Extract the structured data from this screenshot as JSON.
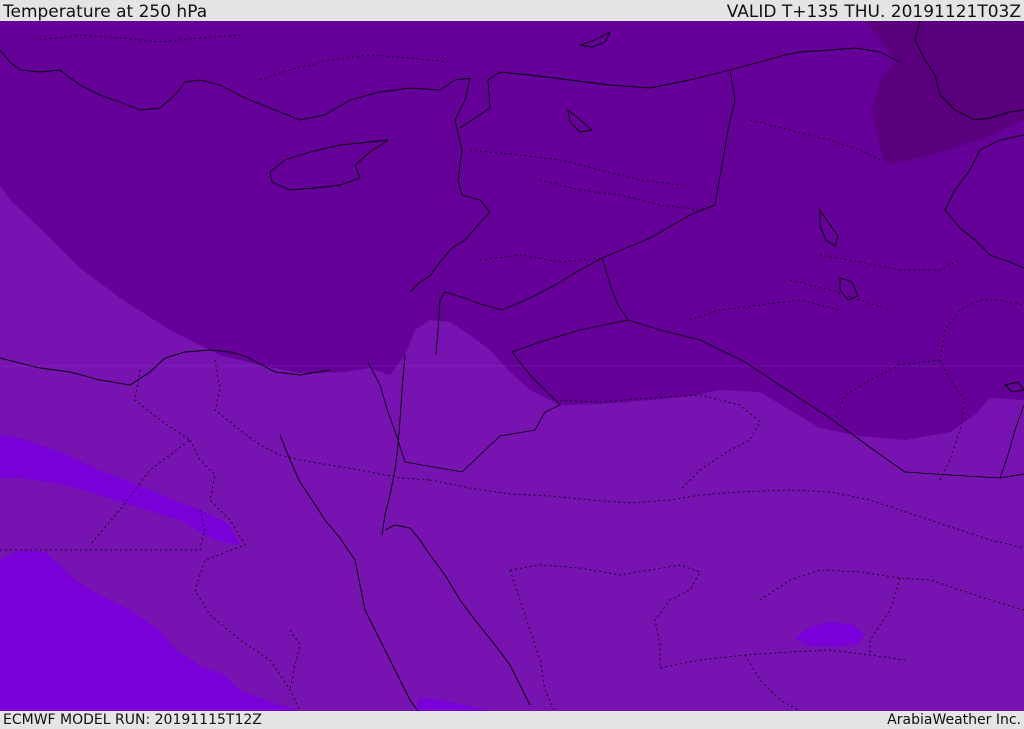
{
  "header": {
    "title": "Temperature at 250 hPa",
    "valid_time": "VALID T+135 THU. 20191121T03Z"
  },
  "footer": {
    "model_run": "ECMWF MODEL RUN: 20191115T12Z",
    "credit": "ArabiaWeather Inc."
  },
  "colors": {
    "band_warmest": "#5a007f",
    "band_warm": "#650099",
    "band_mid": "#7713b0",
    "band_cool": "#7a00d9",
    "band_coolest": "#8300ee",
    "frame_bg": "#e4e4e4",
    "coastline": "#000000"
  }
}
